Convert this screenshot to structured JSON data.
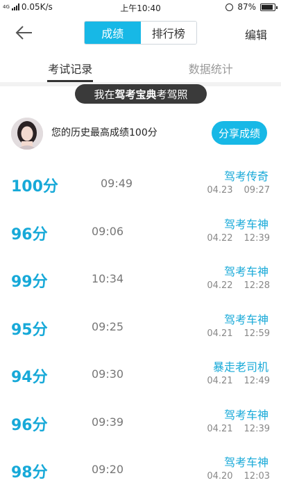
{
  "status_bar": {
    "network_type": "4G",
    "network_type2": "4G",
    "speed": "0.05K/s",
    "time": "上午10:40",
    "battery": "87%",
    "battery_level": 0.87
  },
  "header": {
    "tabs": [
      {
        "label": "成绩",
        "active": true
      },
      {
        "label": "排行榜",
        "active": false
      }
    ],
    "edit_label": "编辑"
  },
  "subtabs": [
    {
      "label": "考试记录",
      "active": true
    },
    {
      "label": "数据统计",
      "active": false
    }
  ],
  "banner": {
    "prefix": "我在",
    "brand": "驾考宝典",
    "suffix": "考驾照"
  },
  "profile": {
    "best_text": "您的历史最高成绩100分",
    "share_label": "分享成绩"
  },
  "records": [
    {
      "score": "100分",
      "duration": "09:49",
      "title": "驾考传奇",
      "date": "04.23",
      "clock": "09:27"
    },
    {
      "score": "96分",
      "duration": "09:06",
      "title": "驾考车神",
      "date": "04.22",
      "clock": "12:39"
    },
    {
      "score": "99分",
      "duration": "10:34",
      "title": "驾考车神",
      "date": "04.22",
      "clock": "12:28"
    },
    {
      "score": "95分",
      "duration": "09:25",
      "title": "驾考车神",
      "date": "04.21",
      "clock": "12:59"
    },
    {
      "score": "94分",
      "duration": "09:30",
      "title": "暴走老司机",
      "date": "04.21",
      "clock": "12:49"
    },
    {
      "score": "96分",
      "duration": "09:39",
      "title": "驾考车神",
      "date": "04.21",
      "clock": "12:39"
    },
    {
      "score": "98分",
      "duration": "09:20",
      "title": "驾考车神",
      "date": "04.20",
      "clock": "12:03"
    }
  ],
  "colors": {
    "accent": "#17b8e6",
    "score": "#17a9d8",
    "banner_bg": "#3a3a3a"
  }
}
